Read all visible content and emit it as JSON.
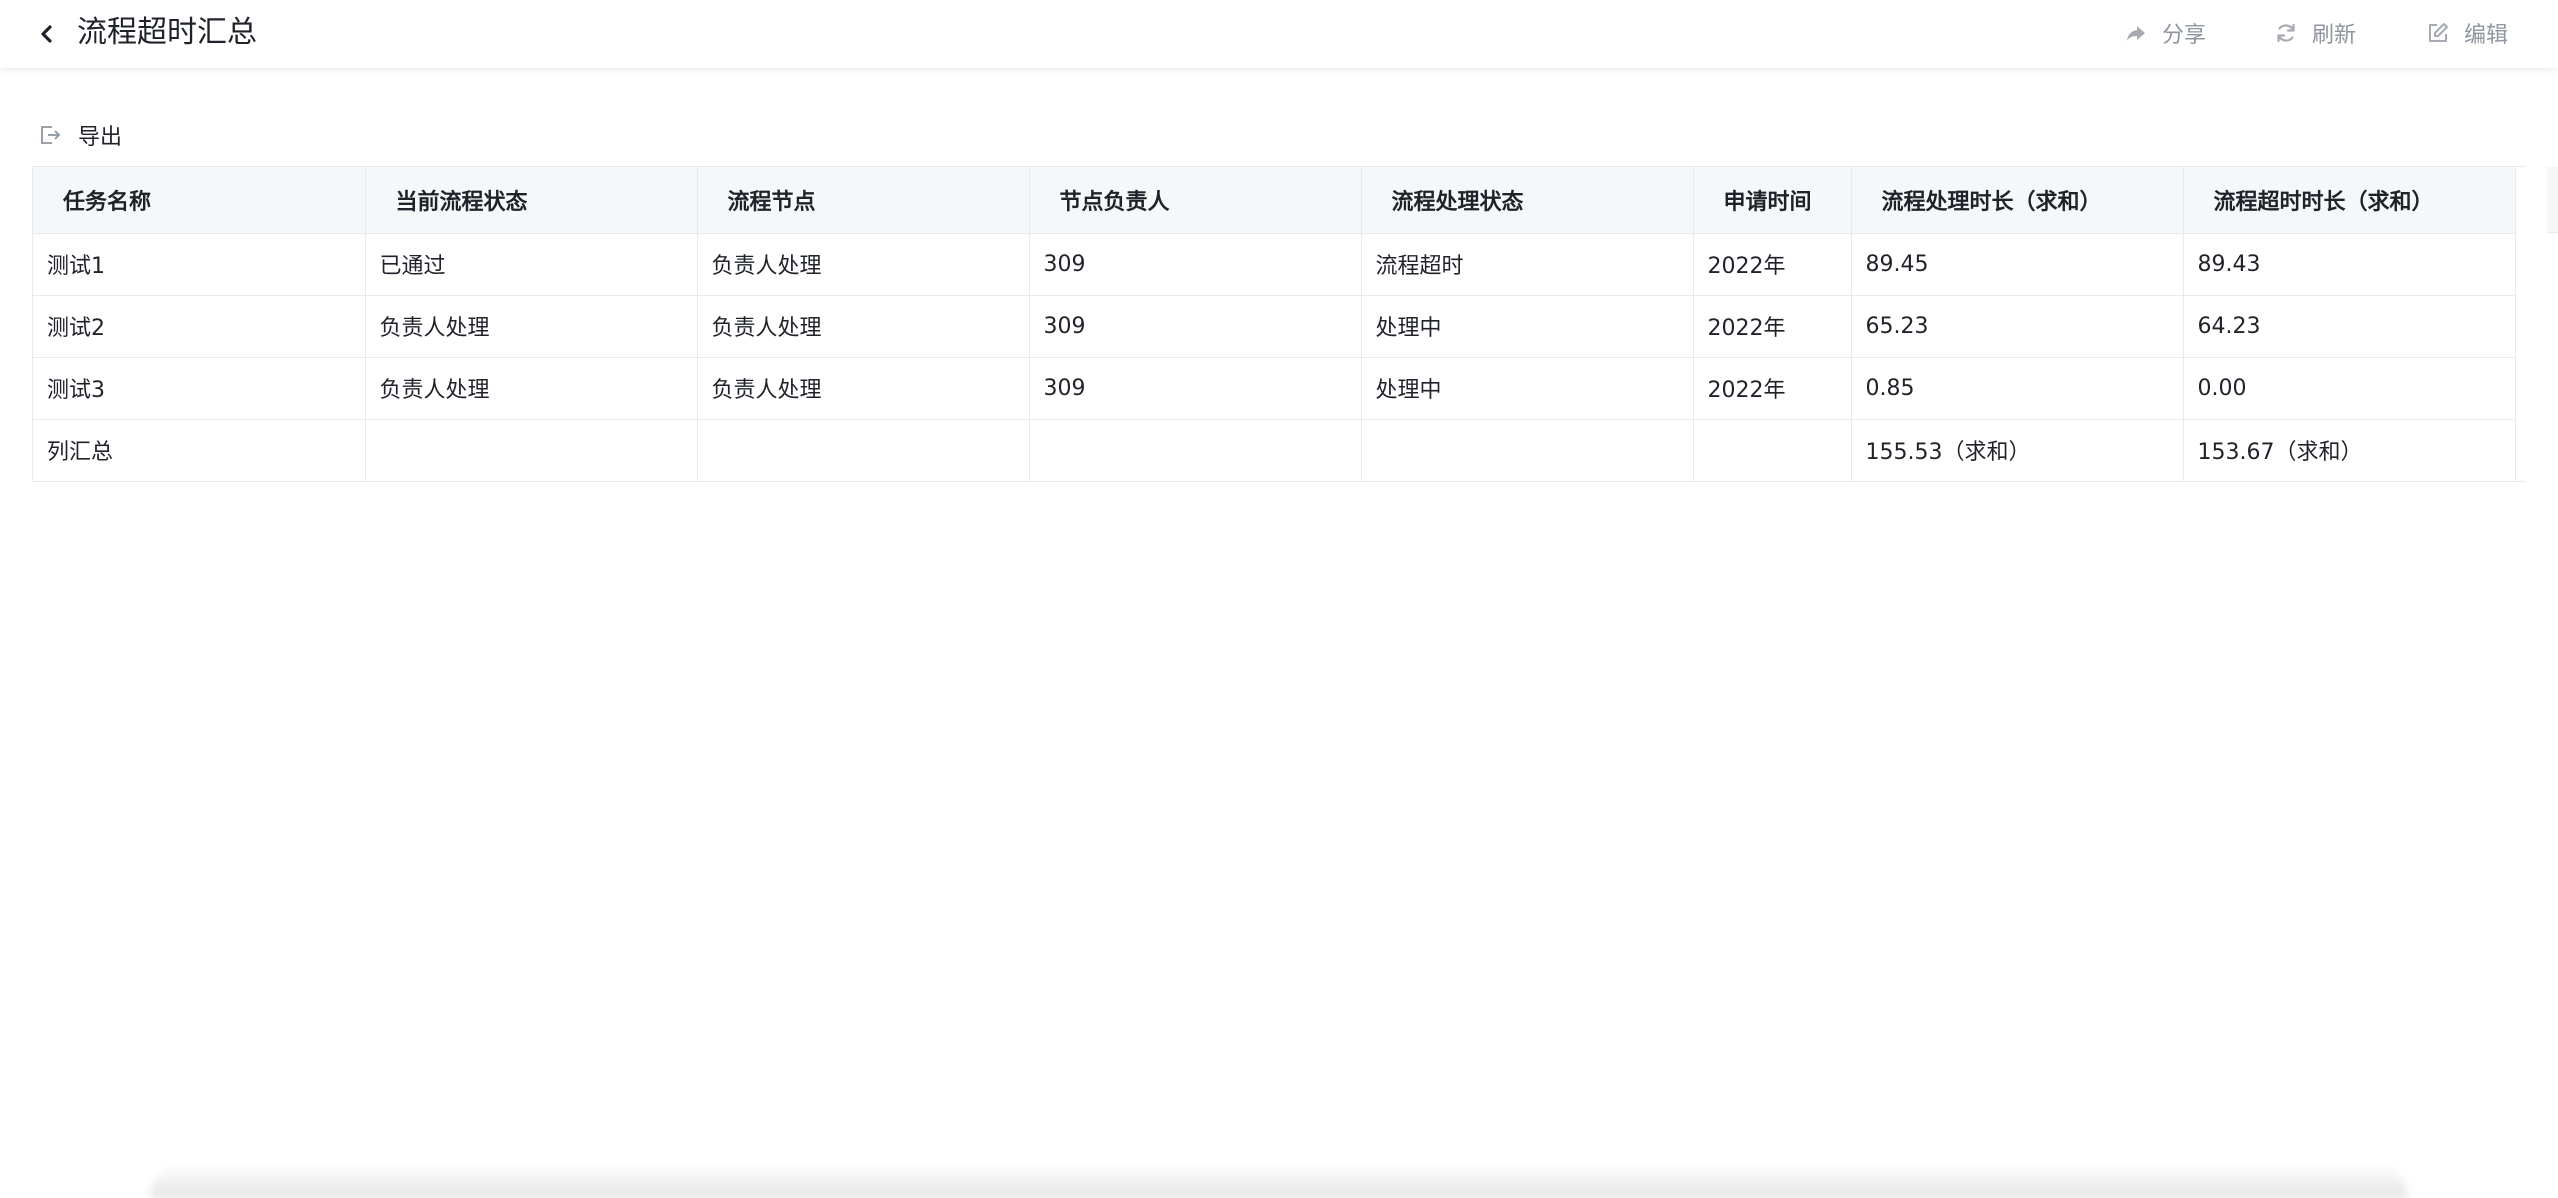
{
  "header": {
    "title": "流程超时汇总",
    "actions": {
      "share": "分享",
      "refresh": "刷新",
      "edit": "编辑"
    }
  },
  "toolbar": {
    "export_label": "导出"
  },
  "table": {
    "columns": [
      "任务名称",
      "当前流程状态",
      "流程节点",
      "节点负责人",
      "流程处理状态",
      "申请时间",
      "流程处理时长（求和）",
      "流程超时时长（求和）"
    ],
    "rows": [
      [
        "测试1",
        "已通过",
        "负责人处理",
        "309",
        "流程超时",
        "2022年",
        "89.45",
        "89.43"
      ],
      [
        "测试2",
        "负责人处理",
        "负责人处理",
        "309",
        "处理中",
        "2022年",
        "65.23",
        "64.23"
      ],
      [
        "测试3",
        "负责人处理",
        "负责人处理",
        "309",
        "处理中",
        "2022年",
        "0.85",
        "0.00"
      ]
    ],
    "summary": [
      "列汇总",
      "",
      "",
      "",
      "",
      "",
      "155.53（求和）",
      "153.67（求和）"
    ]
  },
  "colors": {
    "header_bg": "#f6f7f9",
    "border": "#e8eaed",
    "text": "#1f2329",
    "muted": "#8f959e"
  },
  "icons": {
    "back": "chevron-left-icon",
    "share": "share-arrow-icon",
    "refresh": "refresh-icon",
    "edit": "edit-icon",
    "export": "export-icon"
  }
}
